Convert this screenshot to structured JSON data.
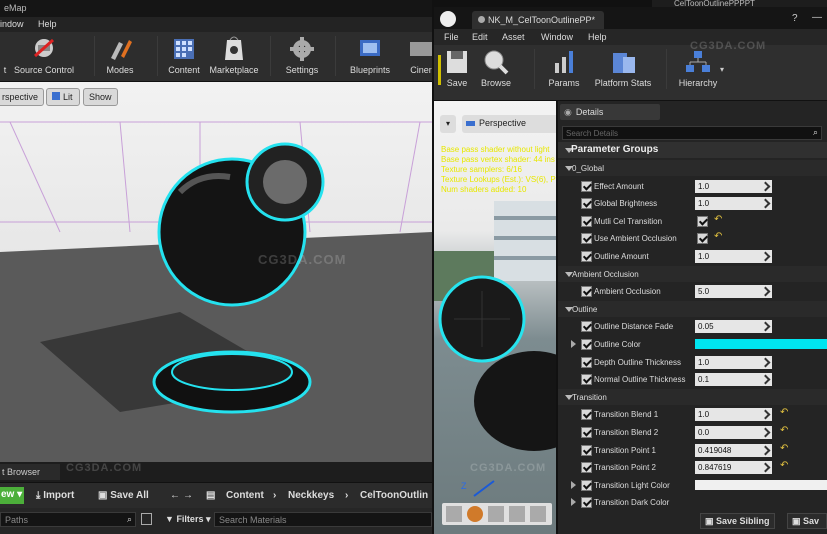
{
  "left_editor": {
    "title": "eMap",
    "menu": [
      "indow",
      "Help"
    ],
    "toolbar": [
      {
        "label": "t",
        "icon": "save-icon"
      },
      {
        "label": "Source Control",
        "icon": "source-control-icon"
      },
      {
        "label": "Modes",
        "icon": "modes-icon"
      },
      {
        "label": "Content",
        "icon": "content-icon"
      },
      {
        "label": "Marketplace",
        "icon": "marketplace-icon"
      },
      {
        "label": "Settings",
        "icon": "settings-icon"
      },
      {
        "label": "Blueprints",
        "icon": "blueprints-icon"
      },
      {
        "label": "Ciner",
        "icon": "cinematics-icon"
      }
    ],
    "viewport": {
      "perspective": "rspective",
      "lit": "Lit",
      "show": "Show"
    },
    "content_browser": {
      "tab": "t Browser",
      "new_label": "ew",
      "import_label": "Import",
      "save_all_label": "Save All",
      "breadcrumb": [
        "Content",
        "Neckkeys",
        "CelToonOutlin"
      ],
      "paths_placeholder": "Paths",
      "filters_label": "Filters",
      "search_placeholder": "Search Materials"
    }
  },
  "top_tab_right": "CelToonOutlinePPPPT",
  "material_editor": {
    "tab_title": "NK_M_CelToonOutlinePP*",
    "menu": [
      "File",
      "Edit",
      "Asset",
      "Window",
      "Help"
    ],
    "toolbar": [
      {
        "label": "Save",
        "icon": "save-icon"
      },
      {
        "label": "Browse",
        "icon": "browse-icon"
      },
      {
        "label": "Params",
        "icon": "params-icon"
      },
      {
        "label": "Platform Stats",
        "icon": "platform-stats-icon"
      },
      {
        "label": "Hierarchy",
        "icon": "hierarchy-icon"
      }
    ],
    "viewport": {
      "perspective": "Perspective",
      "shader_info": [
        "Base pass shader without light",
        "Base pass vertex shader: 44 ins",
        "Texture samplers: 6/16",
        "Texture Lookups (Est.): VS(6), PS",
        "Num shaders added: 10"
      ]
    },
    "details": {
      "tab": "Details",
      "search_placeholder": "Search Details",
      "section": "Parameter Groups",
      "groups": [
        {
          "name": "0_Global",
          "params": [
            {
              "name": "Effect Amount",
              "value": "1.0",
              "type": "scalar"
            },
            {
              "name": "Global Brightness",
              "value": "1.0",
              "type": "scalar"
            },
            {
              "name": "Mutli Cel Transition",
              "value": "",
              "type": "bool",
              "reset": true
            },
            {
              "name": "Use Ambient Occlusion",
              "value": "",
              "type": "bool",
              "reset": true
            },
            {
              "name": "Outline Amount",
              "value": "1.0",
              "type": "scalar"
            }
          ]
        },
        {
          "name": "Ambient Occlusion",
          "params": [
            {
              "name": "Ambient Occlusion",
              "value": "5.0",
              "type": "scalar"
            }
          ]
        },
        {
          "name": "Outline",
          "params": [
            {
              "name": "Outline Distance Fade",
              "value": "0.05",
              "type": "scalar"
            },
            {
              "name": "Outline Color",
              "value": "",
              "type": "color",
              "color": "#00e5f0",
              "expandable": true
            },
            {
              "name": "Depth Outline Thickness",
              "value": "1.0",
              "type": "scalar"
            },
            {
              "name": "Normal Outline Thickness",
              "value": "0.1",
              "type": "scalar"
            }
          ]
        },
        {
          "name": "Transition",
          "params": [
            {
              "name": "Transition Blend 1",
              "value": "1.0",
              "type": "scalar",
              "reset": true
            },
            {
              "name": "Transition Blend 2",
              "value": "0.0",
              "type": "scalar",
              "reset": true
            },
            {
              "name": "Transition Point 1",
              "value": "0.419048",
              "type": "scalar",
              "reset": true
            },
            {
              "name": "Transition Point 2",
              "value": "0.847619",
              "type": "scalar",
              "reset": true
            },
            {
              "name": "Transition Light Color",
              "value": "",
              "type": "color",
              "color": "#f0f0f0",
              "expandable": true
            },
            {
              "name": "Transition Dark Color",
              "value": "",
              "type": "color",
              "color": "",
              "expandable": true
            }
          ]
        }
      ],
      "save_sibling": "Save Sibling",
      "save_child": "Sav"
    }
  },
  "watermark": "CG3DA.COM",
  "colors": {
    "accent": "#00e5f0",
    "panel": "#2c2c2c",
    "checkbox": "#d8d8d8",
    "reset": "#e0c040"
  }
}
